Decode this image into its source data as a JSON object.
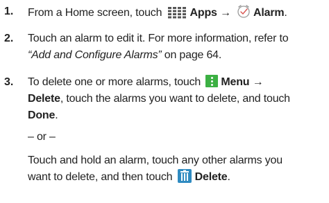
{
  "steps": [
    {
      "number": "1.",
      "lines": [
        {
          "t1": "From a Home screen, touch ",
          "apps": "Apps",
          "arrow": " → ",
          "alarm": "Alarm",
          "end": "."
        }
      ]
    },
    {
      "number": "2.",
      "line1": "Touch an alarm to edit it. For more information, refer to",
      "line2_ref": "“Add and Configure Alarms”",
      "line2_rest": " on page 64."
    },
    {
      "number": "3.",
      "line1_a": "To delete one or more alarms, touch ",
      "line1_menu": "Menu →",
      "line2_delete": "Delete",
      "line2_rest": ", touch the alarms you want to delete, and touch",
      "line3_done": "Done",
      "line3_end": ".",
      "or": "– or –",
      "line5": "Touch and hold an alarm, touch any other alarms you",
      "line6_a": "want to delete, and then touch ",
      "line6_delete": "Delete",
      "line6_end": "."
    }
  ],
  "icons": {
    "apps": "apps-grid-icon",
    "alarm": "alarm-clock-icon",
    "menu": "menu-dots-icon",
    "trash": "trash-can-icon"
  },
  "colors": {
    "text": "#222222",
    "menu_icon": "#3cb043",
    "trash_icon": "#2f8bc1",
    "apps_icon": "#555555",
    "alarm_icon": "#d9534f"
  }
}
